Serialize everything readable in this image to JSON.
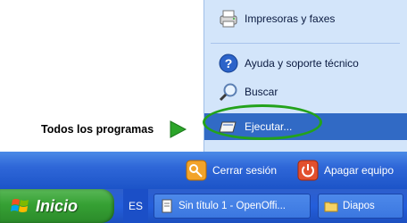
{
  "start_menu": {
    "all_programs": "Todos los programas",
    "right_items": [
      {
        "label": "Impresoras y faxes",
        "icon": "printer-icon"
      },
      {
        "label": "Ayuda y soporte técnico",
        "icon": "help-icon"
      },
      {
        "label": "Buscar",
        "icon": "search-icon"
      },
      {
        "label": "Ejecutar...",
        "icon": "run-icon"
      }
    ],
    "logoff": "Cerrar sesión",
    "shutdown": "Apagar equipo"
  },
  "taskbar": {
    "start_label": "Inicio",
    "language": "ES",
    "tasks": [
      {
        "label": "Sin título 1 - OpenOffi...",
        "icon": "document-icon"
      },
      {
        "label": "Diapos",
        "icon": "folder-icon"
      }
    ]
  },
  "colors": {
    "selection": "#316ac5",
    "right_panel": "#d3e5fa",
    "taskbar_blue": "#245edb",
    "start_green": "#36a134",
    "highlight_circle": "#23a21b"
  }
}
